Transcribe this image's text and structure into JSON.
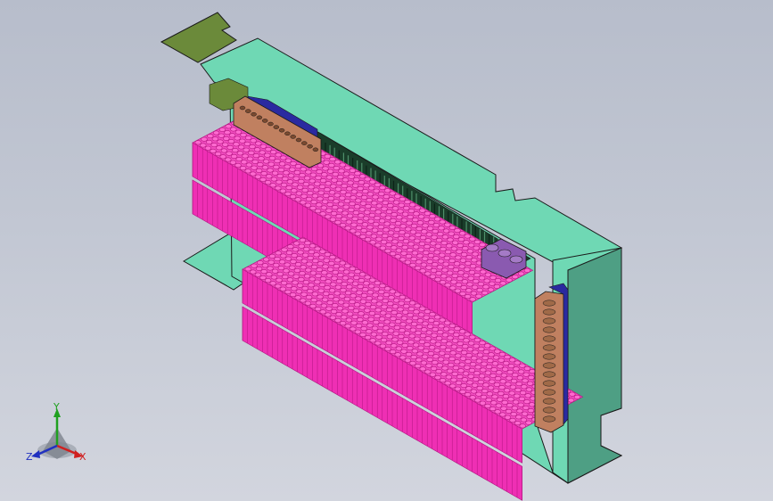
{
  "viewport": {
    "background_top": "#b7bdcb",
    "background_bottom": "#d2d5de"
  },
  "model": {
    "colors": {
      "housing": "#6fd8b4",
      "housing_side": "#4e9f84",
      "cells": "#ef2fb4",
      "cells_dark": "#b0157f",
      "busbar_copper": "#c08060",
      "pcb_dark": "#1a3d2a",
      "connector_green": "#6b8a3a",
      "terminal_purple": "#8a5ab0",
      "insulator_blue": "#2a2aa0",
      "outline": "#1a1a1a"
    }
  },
  "triad": {
    "icon": "xyz-axis-triad-icon",
    "x_label": "X",
    "y_label": "Y",
    "z_label": "Z",
    "x_color": "#d02020",
    "y_color": "#20a020",
    "z_color": "#2030c0"
  }
}
